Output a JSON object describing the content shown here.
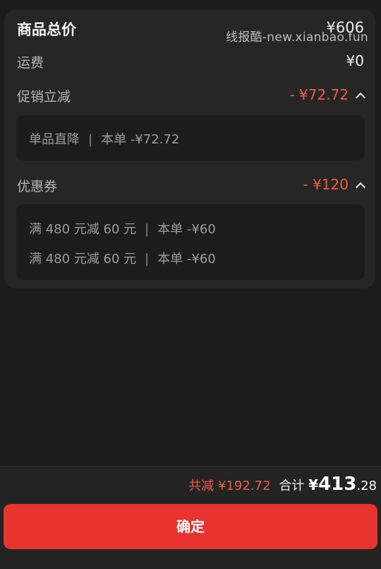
{
  "summary": {
    "goods_total_label": "商品总价",
    "goods_total_value": "¥606",
    "shipping_label": "运费",
    "shipping_value": "¥0",
    "promo_label": "促销立减",
    "promo_value": "- ¥72.72",
    "promo_details": [
      {
        "name": "单品直降",
        "separator": "|",
        "amount": "本单 -¥72.72"
      }
    ],
    "coupon_label": "优惠券",
    "coupon_value": "- ¥120",
    "coupon_details": [
      {
        "name": "满 480 元减 60 元",
        "separator": "|",
        "amount": "本单 -¥60"
      },
      {
        "name": "满 480 元减 60 元",
        "separator": "|",
        "amount": "本单 -¥60"
      }
    ]
  },
  "watermark": "线报酷-new.xianbao.fun",
  "footer": {
    "saved_text": "共减 ¥192.72",
    "total_label": "合计",
    "total_currency": "¥",
    "total_integer": "413",
    "total_decimal": ".28",
    "confirm_label": "确定"
  },
  "colors": {
    "accent_red": "#f05a48",
    "button_red": "#e8332e",
    "background": "#1c1c1c",
    "card": "#262626"
  },
  "icons": [
    "chevron-up-icon"
  ]
}
